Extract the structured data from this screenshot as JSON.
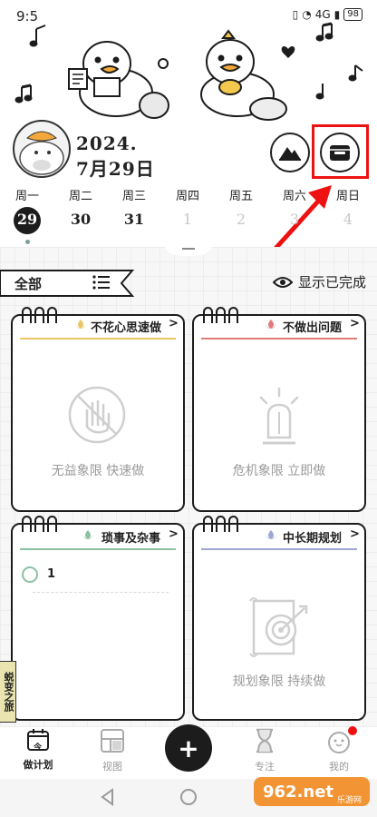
{
  "status_bar": {
    "time": "9:5",
    "network": "4G",
    "battery": "98"
  },
  "header": {
    "date_year": "2024.",
    "date_month_day": "7月29日"
  },
  "week": {
    "days": [
      {
        "weekday": "周一",
        "date": "29",
        "state": "today"
      },
      {
        "weekday": "周二",
        "date": "30",
        "state": "normal"
      },
      {
        "weekday": "周三",
        "date": "31",
        "state": "normal"
      },
      {
        "weekday": "周四",
        "date": "1",
        "state": "muted"
      },
      {
        "weekday": "周五",
        "date": "2",
        "state": "muted"
      },
      {
        "weekday": "周六",
        "date": "3",
        "state": "muted"
      },
      {
        "weekday": "周日",
        "date": "4",
        "state": "muted"
      }
    ]
  },
  "filter": {
    "label": "全部",
    "show_completed": "显示已完成"
  },
  "quadrants": [
    {
      "title": "不花心思速做",
      "caption": "无益象限 快速做",
      "accent": "#e8c766",
      "icon": "hand-stop-icon"
    },
    {
      "title": "不做出问题",
      "caption": "危机象限 立即做",
      "accent": "#e07a7a",
      "icon": "alarm-light-icon"
    },
    {
      "title": "琐事及杂事",
      "caption": "",
      "accent": "#8cc0a2",
      "icon": "",
      "tasks": [
        {
          "text": "1"
        }
      ]
    },
    {
      "title": "中长期规划",
      "caption": "规划象限 持续做",
      "accent": "#9ea6d6",
      "icon": "target-scroll-icon"
    }
  ],
  "side_banner": {
    "text": "蜕变之旅"
  },
  "bottom_nav": {
    "items": [
      {
        "label": "做计划",
        "icon_text": "今",
        "active": true
      },
      {
        "label": "视图",
        "active": false
      },
      {
        "label": "专注",
        "active": false
      },
      {
        "label": "我的",
        "active": false
      }
    ],
    "fab": "+"
  },
  "watermark": {
    "text": "962.net",
    "subtext": "乐游网"
  },
  "colors": {
    "highlight": "#e11111",
    "dark": "#1c1c1c"
  }
}
